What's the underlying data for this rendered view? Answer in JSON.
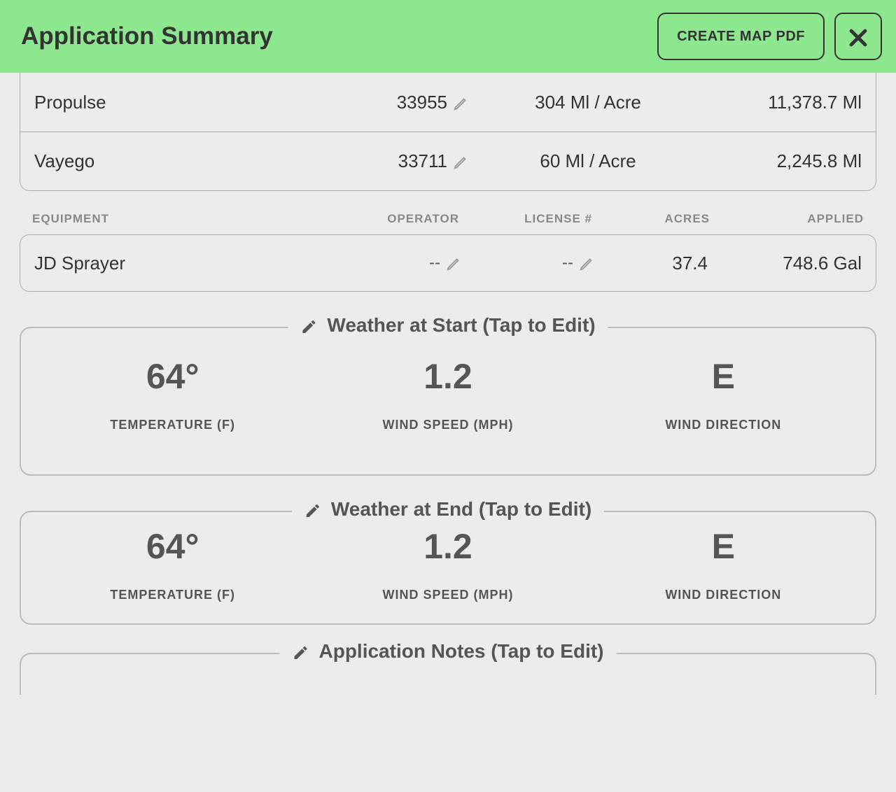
{
  "header": {
    "title": "Application Summary",
    "create_pdf_label": "CREATE MAP PDF"
  },
  "products": [
    {
      "name": "Propulse",
      "code": "33955",
      "rate": "304 Ml / Acre",
      "total": "11,378.7 Ml"
    },
    {
      "name": "Vayego",
      "code": "33711",
      "rate": "60 Ml / Acre",
      "total": "2,245.8 Ml"
    }
  ],
  "equipment_headers": {
    "equipment": "EQUIPMENT",
    "operator": "OPERATOR",
    "license": "LICENSE #",
    "acres": "ACRES",
    "applied": "APPLIED"
  },
  "equipment_row": {
    "name": "JD Sprayer",
    "operator": "--",
    "license": "--",
    "acres": "37.4",
    "applied": "748.6 Gal"
  },
  "weather_start": {
    "title": "Weather at Start (Tap to Edit)",
    "temp_value": "64°",
    "temp_label": "TEMPERATURE (F)",
    "wind_speed_value": "1.2",
    "wind_speed_label": "WIND SPEED (MPH)",
    "wind_dir_value": "E",
    "wind_dir_label": "WIND DIRECTION"
  },
  "weather_end": {
    "title": "Weather at End (Tap to Edit)",
    "temp_value": "64°",
    "temp_label": "TEMPERATURE (F)",
    "wind_speed_value": "1.2",
    "wind_speed_label": "WIND SPEED (MPH)",
    "wind_dir_value": "E",
    "wind_dir_label": "WIND DIRECTION"
  },
  "notes_title": "Application Notes (Tap to Edit)"
}
